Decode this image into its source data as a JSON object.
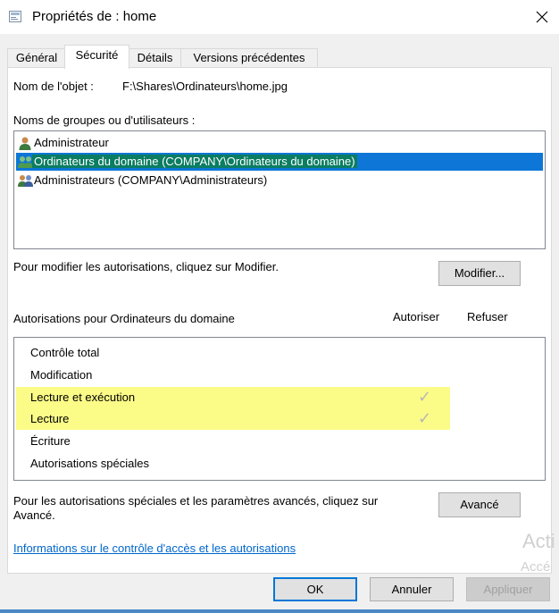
{
  "window": {
    "title": "Propriétés de : home"
  },
  "tabs": [
    {
      "label": "Général"
    },
    {
      "label": "Sécurité"
    },
    {
      "label": "Détails"
    },
    {
      "label": "Versions précédentes"
    }
  ],
  "object": {
    "label": "Nom de l'objet :",
    "value": "F:\\Shares\\Ordinateurs\\home.jpg"
  },
  "groups": {
    "label": "Noms de groupes ou d'utilisateurs :",
    "items": [
      {
        "label": "Administrateur",
        "icon": "user-icon"
      },
      {
        "label": "Ordinateurs du domaine (COMPANY\\Ordinateurs du domaine)",
        "icon": "group-icon",
        "selected": true
      },
      {
        "label": "Administrateurs (COMPANY\\Administrateurs)",
        "icon": "group-icon"
      }
    ]
  },
  "modify": {
    "hint": "Pour modifier les autorisations, cliquez sur Modifier.",
    "button": "Modifier..."
  },
  "permissions": {
    "title": "Autorisations pour Ordinateurs du domaine",
    "col_allow": "Autoriser",
    "col_deny": "Refuser",
    "items": [
      {
        "label": "Contrôle total",
        "allow": false,
        "deny": false,
        "highlight": false
      },
      {
        "label": "Modification",
        "allow": false,
        "deny": false,
        "highlight": false
      },
      {
        "label": "Lecture et exécution",
        "allow": true,
        "deny": false,
        "highlight": true
      },
      {
        "label": "Lecture",
        "allow": true,
        "deny": false,
        "highlight": true
      },
      {
        "label": "Écriture",
        "allow": false,
        "deny": false,
        "highlight": false
      },
      {
        "label": "Autorisations spéciales",
        "allow": false,
        "deny": false,
        "highlight": false
      }
    ]
  },
  "advanced": {
    "hint_line1": "Pour les autorisations spéciales et les paramètres avancés, cliquez sur",
    "hint_line2": "Avancé.",
    "button": "Avancé"
  },
  "info_link": "Informations sur le contrôle d'accès et les autorisations",
  "footer": {
    "ok": "OK",
    "cancel": "Annuler",
    "apply": "Appliquer"
  },
  "watermark": {
    "line1": "Acti",
    "line2": "Accé"
  },
  "colors": {
    "selection_green": "#0a7d62",
    "selection_blue": "#0d76d6",
    "highlight": "#fbfb88",
    "link": "#0066cc"
  }
}
